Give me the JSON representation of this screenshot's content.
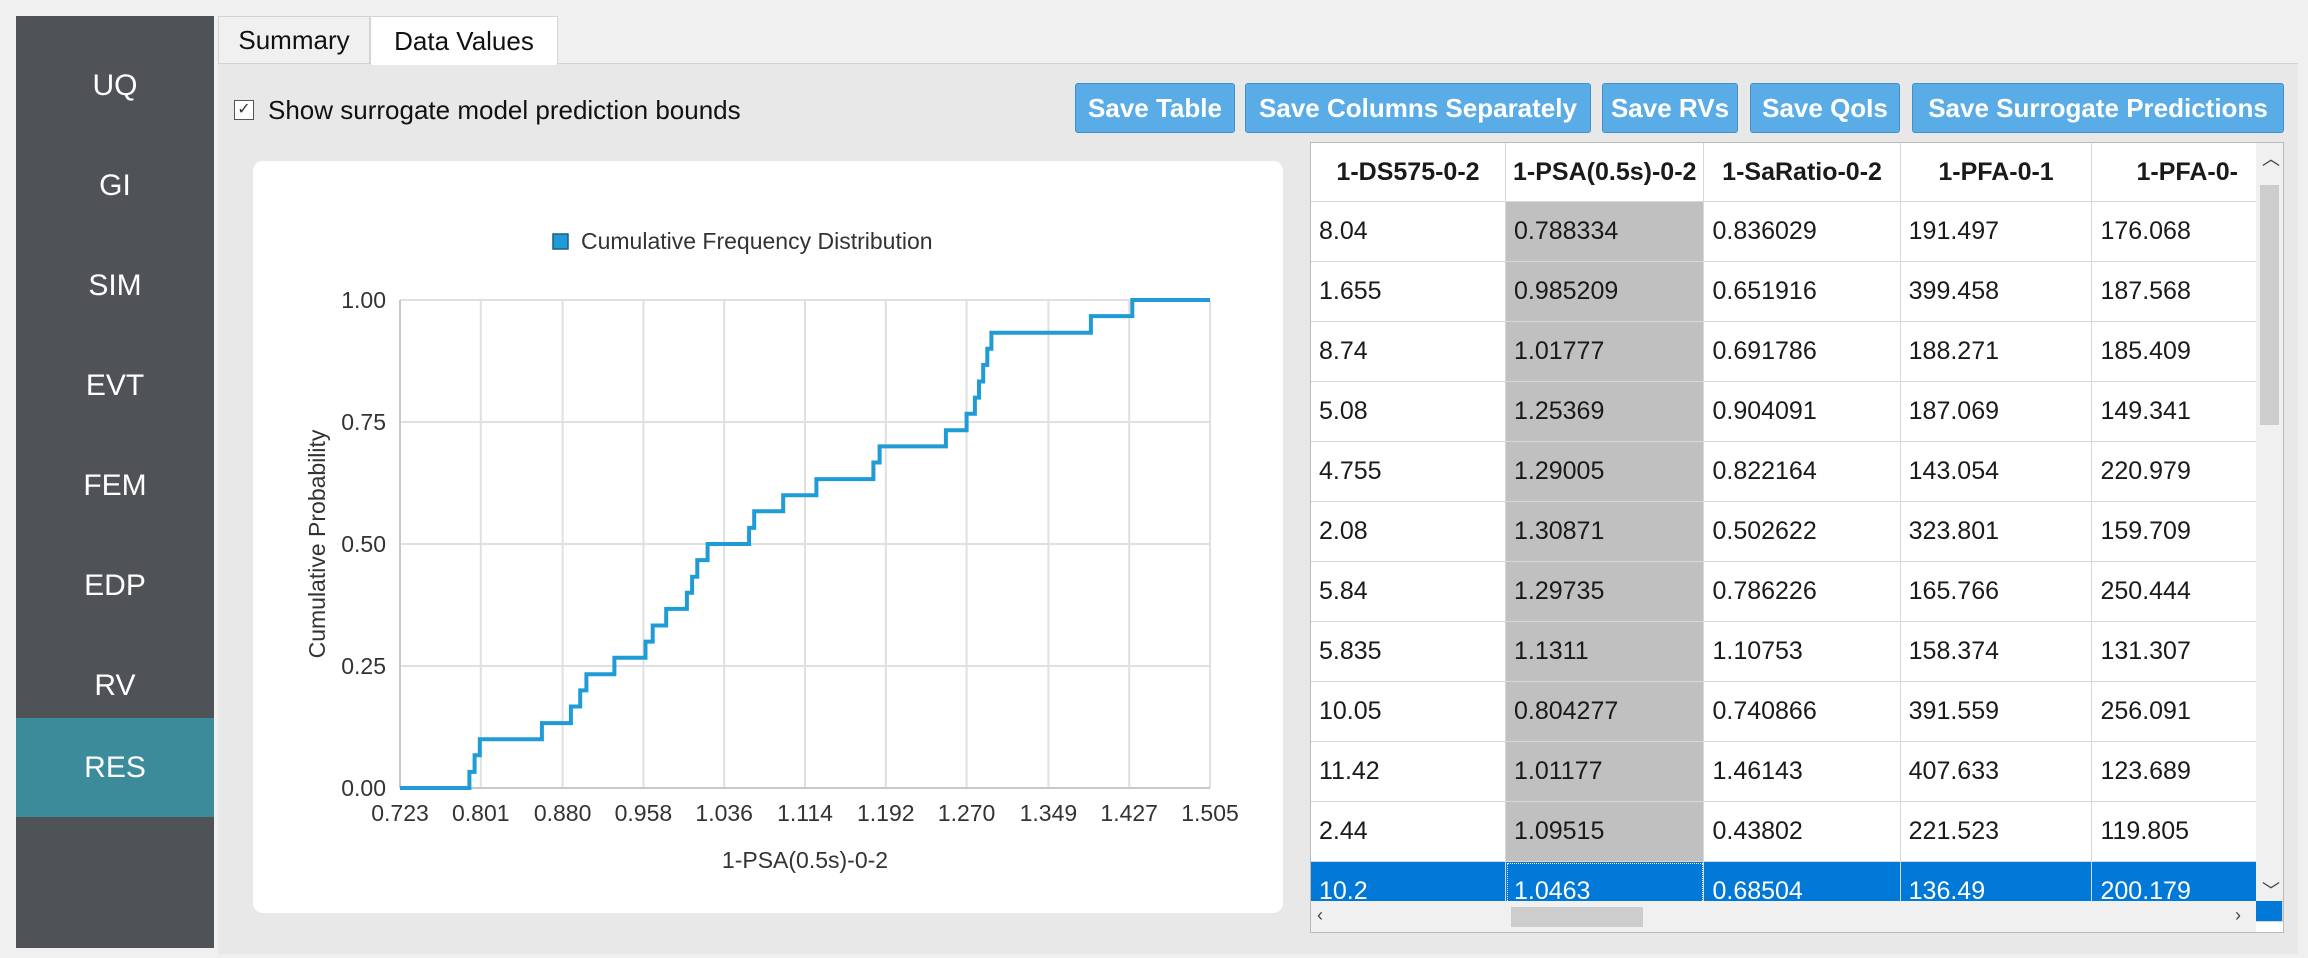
{
  "sidebar": {
    "items": [
      {
        "label": "UQ"
      },
      {
        "label": "GI"
      },
      {
        "label": "SIM"
      },
      {
        "label": "EVT"
      },
      {
        "label": "FEM"
      },
      {
        "label": "EDP"
      },
      {
        "label": "RV"
      },
      {
        "label": "RES"
      }
    ],
    "active": "RES"
  },
  "tabs": [
    {
      "label": "Summary"
    },
    {
      "label": "Data Values"
    }
  ],
  "active_tab": "Data Values",
  "options": {
    "bounds_label": "Show surrogate model prediction bounds",
    "bounds_checked": true
  },
  "toolbar": {
    "save_table": "Save Table",
    "save_columns": "Save Columns Separately",
    "save_rvs": "Save RVs",
    "save_qois": "Save QoIs",
    "save_surrogate": "Save Surrogate Predictions"
  },
  "chart_data": {
    "type": "line",
    "step": true,
    "legend": "Cumulative Frequency Distribution",
    "legend_position": "top-center",
    "xlabel": "1-PSA(0.5s)-0-2",
    "ylabel": "Cumulative Probability",
    "xlim": [
      0.723,
      1.505
    ],
    "ylim": [
      0,
      1
    ],
    "grid": true,
    "xticks": [
      "0.723",
      "0.801",
      "0.880",
      "0.958",
      "1.036",
      "1.114",
      "1.192",
      "1.270",
      "1.349",
      "1.427",
      "1.505"
    ],
    "yticks": [
      "0.00",
      "0.25",
      "0.50",
      "0.75",
      "1.00"
    ],
    "color": "#1f9bd6",
    "series": [
      {
        "x": [
          0.723,
          0.79,
          0.79,
          0.795,
          0.795,
          0.8,
          0.8,
          0.806,
          0.806,
          0.86,
          0.86,
          0.888,
          0.888,
          0.897,
          0.897,
          0.903,
          0.903,
          0.93,
          0.93,
          0.96,
          0.96,
          0.967,
          0.967,
          0.98,
          0.98,
          1.0,
          1.0,
          1.005,
          1.005,
          1.01,
          1.01,
          1.02,
          1.02,
          1.06,
          1.06,
          1.065,
          1.065,
          1.093,
          1.093,
          1.125,
          1.125,
          1.18,
          1.18,
          1.186,
          1.186,
          1.25,
          1.25,
          1.27,
          1.27,
          1.278,
          1.278,
          1.282,
          1.282,
          1.286,
          1.286,
          1.29,
          1.29,
          1.294,
          1.294,
          1.298,
          1.298,
          1.39,
          1.39,
          1.43,
          1.43,
          1.505
        ],
        "y": [
          0.0,
          0.0,
          0.033,
          0.033,
          0.067,
          0.067,
          0.1,
          0.1,
          0.1,
          0.1,
          0.133,
          0.133,
          0.167,
          0.167,
          0.2,
          0.2,
          0.233,
          0.233,
          0.267,
          0.267,
          0.3,
          0.3,
          0.333,
          0.333,
          0.367,
          0.367,
          0.4,
          0.4,
          0.433,
          0.433,
          0.467,
          0.467,
          0.5,
          0.5,
          0.533,
          0.533,
          0.567,
          0.567,
          0.6,
          0.6,
          0.633,
          0.633,
          0.667,
          0.667,
          0.7,
          0.7,
          0.733,
          0.733,
          0.767,
          0.767,
          0.8,
          0.8,
          0.833,
          0.833,
          0.867,
          0.867,
          0.9,
          0.9,
          0.933,
          0.933,
          0.933,
          0.933,
          0.967,
          0.967,
          1.0,
          1.0
        ]
      }
    ]
  },
  "table": {
    "columns": [
      "1-DS575-0-2",
      "1-PSA(0.5s)-0-2",
      "1-SaRatio-0-2",
      "1-PFA-0-1",
      "1-PFA-0-"
    ],
    "highlighted_column": 1,
    "selected_row": 11,
    "rows": [
      [
        "8.04",
        "0.788334",
        "0.836029",
        "191.497",
        "176.068"
      ],
      [
        "1.655",
        "0.985209",
        "0.651916",
        "399.458",
        "187.568"
      ],
      [
        "8.74",
        "1.01777",
        "0.691786",
        "188.271",
        "185.409"
      ],
      [
        "5.08",
        "1.25369",
        "0.904091",
        "187.069",
        "149.341"
      ],
      [
        "4.755",
        "1.29005",
        "0.822164",
        "143.054",
        "220.979"
      ],
      [
        "2.08",
        "1.30871",
        "0.502622",
        "323.801",
        "159.709"
      ],
      [
        "5.84",
        "1.29735",
        "0.786226",
        "165.766",
        "250.444"
      ],
      [
        "5.835",
        "1.1311",
        "1.10753",
        "158.374",
        "131.307"
      ],
      [
        "10.05",
        "0.804277",
        "0.740866",
        "391.559",
        "256.091"
      ],
      [
        "11.42",
        "1.01177",
        "1.46143",
        "407.633",
        "123.689"
      ],
      [
        "2.44",
        "1.09515",
        "0.43802",
        "221.523",
        "119.805"
      ],
      [
        "10.2",
        "1.0463",
        "0.68504",
        "136.49",
        "200.179"
      ]
    ]
  }
}
